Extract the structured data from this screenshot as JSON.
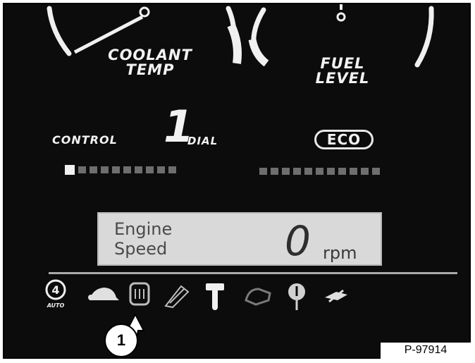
{
  "gauges": {
    "coolant": {
      "line1": "COOLANT",
      "line2": "TEMP"
    },
    "fuel": {
      "line1": "FUEL",
      "line2": "LEVEL"
    }
  },
  "control": {
    "label": "CONTROL",
    "dial_number": "1",
    "dial_label": "DIAL",
    "segments_total": 10,
    "segments_lit": 1
  },
  "eco": {
    "badge": "ECO",
    "segments_total": 11,
    "segments_lit": 0
  },
  "lcd": {
    "line1": "Engine",
    "line2": "Speed",
    "rpm_value": "0",
    "rpm_unit": "rpm"
  },
  "indicators": [
    {
      "icon": "auto-idle-icon",
      "text": "AUTO"
    },
    {
      "icon": "turtle-icon"
    },
    {
      "icon": "engine-preheat-icon"
    },
    {
      "icon": "wiper-icon"
    },
    {
      "icon": "hammer-icon"
    },
    {
      "icon": "hand-icon"
    },
    {
      "icon": "pedal-icon"
    },
    {
      "icon": "crusher-icon"
    }
  ],
  "callout": {
    "number": "1"
  },
  "reference": "P-97914",
  "colors": {
    "background": "#0c0c0c",
    "lit": "#f0f0f0",
    "lcd": "#d9d9d9"
  }
}
